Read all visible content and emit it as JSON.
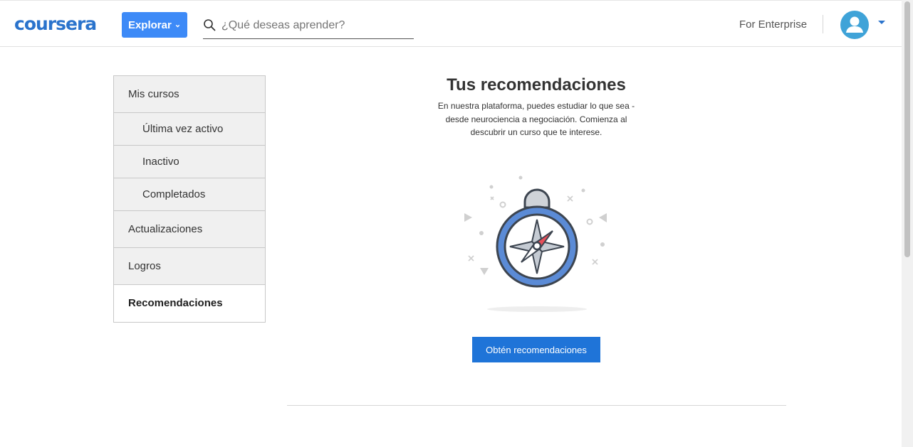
{
  "header": {
    "logo_text": "coursera",
    "explore_label": "Explorar",
    "search_placeholder": "¿Qué deseas aprender?",
    "enterprise_label": "For Enterprise"
  },
  "sidebar": {
    "items": [
      {
        "label": "Mis cursos"
      },
      {
        "label": "Última vez activo"
      },
      {
        "label": "Inactivo"
      },
      {
        "label": "Completados"
      },
      {
        "label": "Actualizaciones"
      },
      {
        "label": "Logros"
      },
      {
        "label": "Recomendaciones"
      }
    ]
  },
  "main": {
    "title": "Tus recomendaciones",
    "description": "En nuestra plataforma, puedes estudiar lo que sea - desde neurociencia a negociación. Comienza al descubrir un curso que te interese.",
    "cta_label": "Obtén recomendaciones",
    "illustration_icon": "compass-icon"
  },
  "colors": {
    "brand": "#2a73cc",
    "explore_button": "#3d8af7",
    "cta_button": "#1f74d8",
    "avatar": "#3fa3d8",
    "compass_accent": "#e8505b"
  }
}
